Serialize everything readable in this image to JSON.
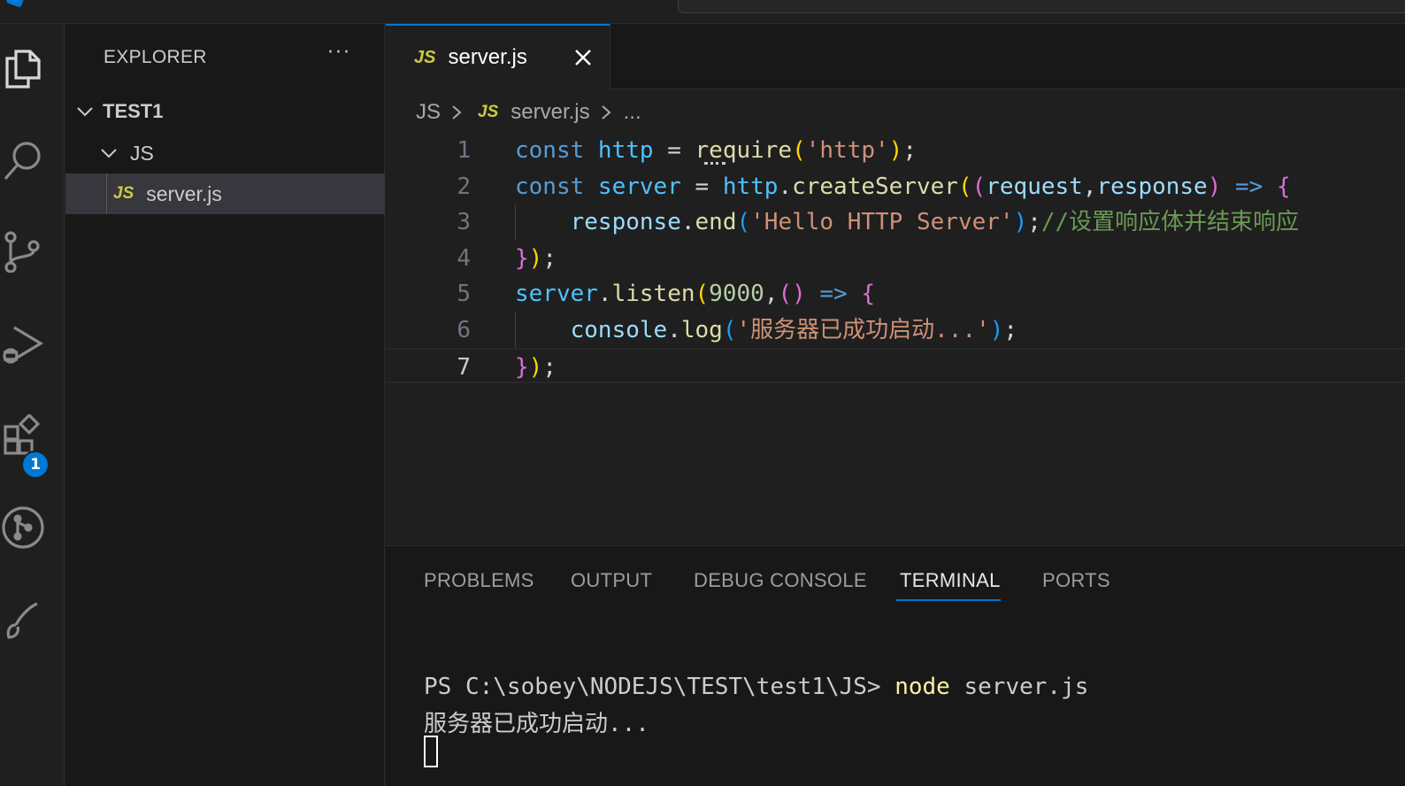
{
  "explorer": {
    "title": "EXPLORER",
    "more": "···",
    "root": "TEST1",
    "folder": "JS",
    "file": "server.js",
    "file_icon": "JS"
  },
  "activity_bar": {
    "items": [
      "files-icon",
      "search-icon",
      "source-control-icon",
      "run-debug-icon",
      "extensions-icon",
      "git-graph-icon",
      "brush-icon"
    ],
    "extensions_badge": "1"
  },
  "editor": {
    "tab_icon": "JS",
    "tab_label": "server.js",
    "breadcrumb": {
      "folder": "JS",
      "file_icon": "JS",
      "file": "server.js",
      "more": "..."
    },
    "line_numbers": [
      "1",
      "2",
      "3",
      "4",
      "5",
      "6",
      "7"
    ],
    "lines": [
      [
        [
          "k",
          "const "
        ],
        [
          "v",
          "http"
        ],
        [
          "p",
          " = "
        ],
        [
          "f",
          "require"
        ],
        [
          "b1",
          "("
        ],
        [
          "s",
          "'http'"
        ],
        [
          "b1",
          ")"
        ],
        [
          "p",
          ";"
        ]
      ],
      [
        [
          "k",
          "const "
        ],
        [
          "v",
          "server"
        ],
        [
          "p",
          " = "
        ],
        [
          "v",
          "http"
        ],
        [
          "p",
          "."
        ],
        [
          "f",
          "createServer"
        ],
        [
          "b1",
          "("
        ],
        [
          "b2",
          "("
        ],
        [
          "prm",
          "request"
        ],
        [
          "p",
          ","
        ],
        [
          "prm",
          "response"
        ],
        [
          "b2",
          ")"
        ],
        [
          "k",
          " => "
        ],
        [
          "b2",
          "{"
        ]
      ],
      [
        [
          "p",
          "    "
        ],
        [
          "prm",
          "response"
        ],
        [
          "p",
          "."
        ],
        [
          "f",
          "end"
        ],
        [
          "b3",
          "("
        ],
        [
          "s",
          "'Hello HTTP Server'"
        ],
        [
          "b3",
          ")"
        ],
        [
          "p",
          ";"
        ],
        [
          "c",
          "//设置响应体并结束响应"
        ]
      ],
      [
        [
          "b2",
          "}"
        ],
        [
          "b1",
          ")"
        ],
        [
          "p",
          ";"
        ]
      ],
      [
        [
          "v",
          "server"
        ],
        [
          "p",
          "."
        ],
        [
          "f",
          "listen"
        ],
        [
          "b1",
          "("
        ],
        [
          "n",
          "9000"
        ],
        [
          "p",
          ","
        ],
        [
          "b2",
          "()"
        ],
        [
          "k",
          " => "
        ],
        [
          "b2",
          "{"
        ]
      ],
      [
        [
          "p",
          "    "
        ],
        [
          "prm",
          "console"
        ],
        [
          "p",
          "."
        ],
        [
          "f",
          "log"
        ],
        [
          "b3",
          "("
        ],
        [
          "s",
          "'服务器已成功启动...'"
        ],
        [
          "b3",
          ")"
        ],
        [
          "p",
          ";"
        ]
      ],
      [
        [
          "b2",
          "}"
        ],
        [
          "b1",
          ")"
        ],
        [
          "p",
          ";"
        ]
      ]
    ]
  },
  "panel": {
    "tabs": [
      "PROBLEMS",
      "OUTPUT",
      "DEBUG CONSOLE",
      "TERMINAL",
      "PORTS"
    ],
    "active_tab": "TERMINAL",
    "terminal": {
      "prompt": "PS C:\\sobey\\NODEJS\\TEST\\test1\\JS> ",
      "command": "node",
      "args": " server.js",
      "output": "服务器已成功启动..."
    }
  },
  "colors": {
    "accent": "#0078d4",
    "js_icon": "#cbcb41"
  }
}
